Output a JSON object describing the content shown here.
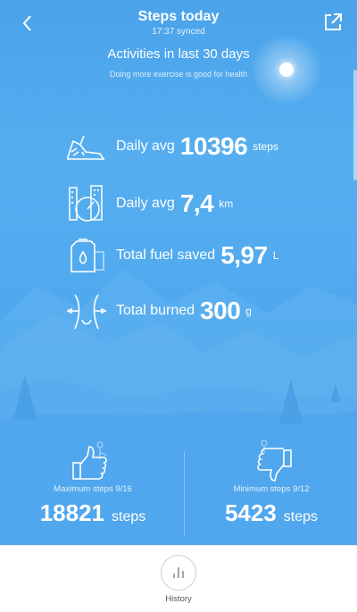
{
  "header": {
    "title": "Steps today",
    "synced": "17:37 synced"
  },
  "activities": {
    "title": "Activities in last 30 days",
    "subtitle": "Doing more exercise is good for health"
  },
  "stats": [
    {
      "label": "Daily avg",
      "value": "10396",
      "unit": "steps",
      "icon": "sneaker-icon"
    },
    {
      "label": "Daily avg",
      "value": "7,4",
      "unit": "km",
      "icon": "speedometer-icon"
    },
    {
      "label": "Total fuel saved",
      "value": "5,97",
      "unit": "L",
      "icon": "fuel-can-icon"
    },
    {
      "label": "Total burned",
      "value": "300",
      "unit": "g",
      "icon": "waist-icon"
    }
  ],
  "max": {
    "label": "Maximum steps 9/16",
    "value": "18821",
    "unit": "steps",
    "icon": "thumbs-up-icon"
  },
  "min": {
    "label": "Minimum steps 9/12",
    "value": "5423",
    "unit": "steps",
    "icon": "thumbs-down-icon"
  },
  "footer": {
    "history_label": "History",
    "icon": "bar-chart-icon"
  },
  "colors": {
    "sky_top": "#4aa3ea",
    "sky_bottom": "#3e9ae6",
    "footer_bg": "#ffffff"
  }
}
